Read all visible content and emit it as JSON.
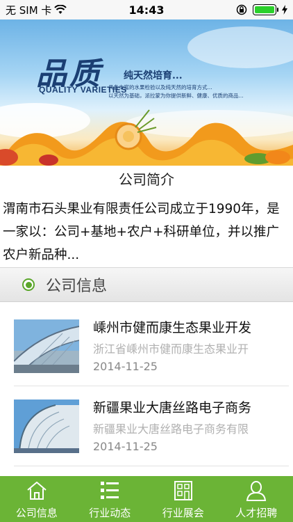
{
  "status_bar": {
    "carrier": "无 SIM 卡",
    "time": "14:43",
    "battery_level": 1.0,
    "battery_color": "#2bd02b"
  },
  "banner": {
    "logo_cn": "品质",
    "logo_en": "QUALITY VARIETIES",
    "slogan": "纯天然培育...",
    "desc_line1": "具备丰富的水果检验以及纯天然的培育方式...",
    "desc_line2": "以天然为基础，派拉蒙为你提供新鲜、健康、优质的商品..."
  },
  "intro": {
    "title": "公司简介",
    "text": "渭南市石头果业有限责任公司成立于1990年，是一家以：公司+基地+农户+科研单位，并以推广农户新品种..."
  },
  "section": {
    "title": "公司信息",
    "accent": "#5aa62a"
  },
  "news": [
    {
      "title": "嵊州市健而康生态果业开发",
      "desc": "浙江省嵊州市健而康生态果业开",
      "date": "2014-11-25",
      "thumb_icon": "building-photo-icon"
    },
    {
      "title": "新疆果业大唐丝路电子商务",
      "desc": "新疆果业大唐丝路电子商务有限",
      "date": "2014-11-25",
      "thumb_icon": "building-photo-icon"
    }
  ],
  "tab_bar": {
    "color": "#6bb436",
    "tabs": [
      {
        "label": "公司信息",
        "icon": "home-icon"
      },
      {
        "label": "行业动态",
        "icon": "list-icon"
      },
      {
        "label": "行业展会",
        "icon": "grid-building-icon"
      },
      {
        "label": "人才招聘",
        "icon": "person-icon"
      }
    ]
  }
}
